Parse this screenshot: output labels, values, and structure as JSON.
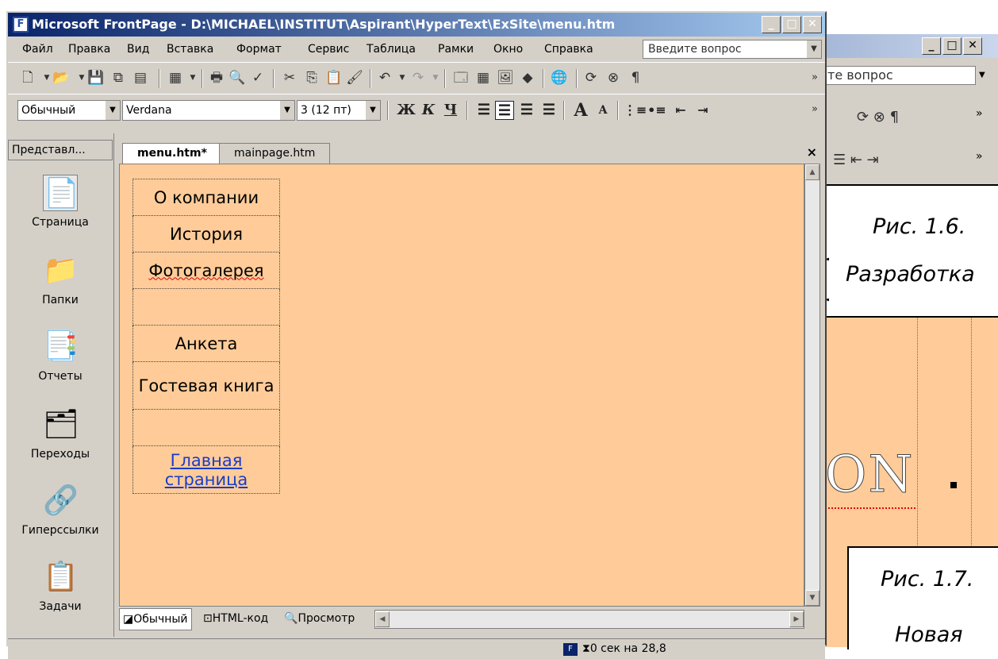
{
  "main_window": {
    "title": "Microsoft FrontPage - D:\\MICHAEL\\INSTITUT\\Aspirant\\HyperText\\ExSite\\menu.htm",
    "controls": {
      "minimize": "_",
      "maximize": "□",
      "close": "✕"
    }
  },
  "menubar": {
    "items": [
      "Файл",
      "Правка",
      "Вид",
      "Вставка",
      "Формат",
      "Сервис",
      "Таблица",
      "Рамки",
      "Окно",
      "Справка"
    ],
    "help_placeholder": "Введите вопрос"
  },
  "formatting": {
    "style": "Обычный",
    "font": "Verdana",
    "size": "3 (12 пт)",
    "bold": "Ж",
    "italic": "К",
    "underline": "Ч"
  },
  "views_bar": {
    "header": "Представл...",
    "items": [
      {
        "label": "Страница",
        "icon": "page-icon",
        "selected": true
      },
      {
        "label": "Папки",
        "icon": "folder-icon",
        "selected": false
      },
      {
        "label": "Отчеты",
        "icon": "reports-icon",
        "selected": false
      },
      {
        "label": "Переходы",
        "icon": "navigation-icon",
        "selected": false
      },
      {
        "label": "Гиперссылки",
        "icon": "hyperlinks-icon",
        "selected": false
      },
      {
        "label": "Задачи",
        "icon": "tasks-icon",
        "selected": false
      }
    ]
  },
  "editor": {
    "tabs": [
      {
        "label": "menu.htm*",
        "active": true
      },
      {
        "label": "mainpage.htm",
        "active": false
      }
    ],
    "close": "×",
    "page_background": "#ffcc99",
    "menu_cells": [
      {
        "text": "О компании",
        "link": false,
        "spelling_error": false
      },
      {
        "text": "История",
        "link": false,
        "spelling_error": false
      },
      {
        "text": "Фотогалерея",
        "link": false,
        "spelling_error": true
      },
      {
        "text": "",
        "link": false,
        "spelling_error": false
      },
      {
        "text": "Анкета",
        "link": false,
        "spelling_error": false
      },
      {
        "text": "Гостевая книга",
        "link": false,
        "spelling_error": false
      },
      {
        "text": "",
        "link": false,
        "spelling_error": false
      },
      {
        "text": "Главная страница",
        "link": true,
        "spelling_error": false
      }
    ],
    "view_tabs": [
      "Обычный",
      "HTML-код",
      "Просмотр"
    ]
  },
  "status": {
    "text": "0 сек на 28,8"
  },
  "background_window": {
    "help_text": "те вопрос",
    "doc_text": "ON"
  },
  "callouts": {
    "fig1": "Рис. 1.6.",
    "fig1_text": "Разработка",
    "fig2": "Рис. 1.7.",
    "fig2_text": "Новая"
  }
}
